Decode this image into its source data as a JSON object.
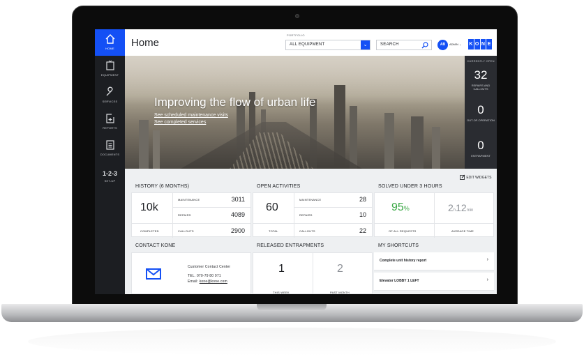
{
  "sidebar": {
    "items": [
      {
        "label": "HOME",
        "icon": "home-icon"
      },
      {
        "label": "EQUIPMENT",
        "icon": "equipment-icon"
      },
      {
        "label": "SERVICES",
        "icon": "wrench-icon"
      },
      {
        "label": "REPORTS",
        "icon": "add-report-icon"
      },
      {
        "label": "DOCUMENTS",
        "icon": "document-icon"
      }
    ],
    "setup": {
      "number": "1-2-3",
      "label": "SET-UP"
    }
  },
  "header": {
    "title": "Home",
    "portfolio_label": "PORTFOLIO",
    "portfolio_value": "ALL EQUIPMENT",
    "search_placeholder": "SEARCH",
    "avatar_initials": "AB",
    "user_name": "ADMIN",
    "logo_letters": [
      "K",
      "O",
      "N",
      "E"
    ],
    "accent_color": "#1450f5"
  },
  "hero": {
    "title": "Improving the flow of urban life",
    "link_maintenance": "See scheduled maintenance visits",
    "link_services": "See completed services"
  },
  "stats": {
    "heading": "CURRENTLY OPEN",
    "items": [
      {
        "value": "32",
        "label": "REPAIRS AND CALLOUTS"
      },
      {
        "value": "0",
        "label": "OUT-OF-OPERATION"
      },
      {
        "value": "0",
        "label": "ENTRAPMENT"
      }
    ]
  },
  "widgets": {
    "edit_label": "EDIT WIDGETS",
    "history": {
      "title": "HISTORY (6 MONTHS)",
      "total": "10k",
      "total_label": "COMPLETED",
      "rows": [
        {
          "label": "MAINTENANCE",
          "value": "3011"
        },
        {
          "label": "REPAIRS",
          "value": "4089"
        },
        {
          "label": "CALLOUTS",
          "value": "2900"
        }
      ]
    },
    "open_activities": {
      "title": "OPEN ACTIVITIES",
      "total": "60",
      "total_label": "TOTAL",
      "rows": [
        {
          "label": "MAINTENANCE",
          "value": "28"
        },
        {
          "label": "REPAIRS",
          "value": "10"
        },
        {
          "label": "CALLOUTS",
          "value": "22"
        }
      ]
    },
    "solved": {
      "title": "SOLVED UNDER 3 HOURS",
      "percent": "95",
      "percent_sign": "%",
      "percent_label": "OF ALL REQUESTS",
      "hours": "2",
      "hours_unit": "h",
      "minutes": "12",
      "minutes_unit": "min",
      "time_label": "AVERAGE TIME",
      "percent_color": "#3aa845"
    },
    "contact": {
      "title": "CONTACT KONE",
      "center": "Customer Contact Center",
      "tel": "TEL. 070-79 80 971",
      "email_prefix": "Email:",
      "email": "kone@kone.com"
    },
    "entrapments": {
      "title": "RELEASED ENTRAPMENTS",
      "this_week": "1",
      "this_week_label": "THIS WEEK",
      "past_month": "2",
      "past_month_label": "PAST MONTH"
    },
    "shortcuts": {
      "title": "MY SHORTCUTS",
      "items": [
        {
          "label": "Complete unit history report"
        },
        {
          "label": "Elevator LOBBY 1 LEFT"
        }
      ]
    }
  }
}
